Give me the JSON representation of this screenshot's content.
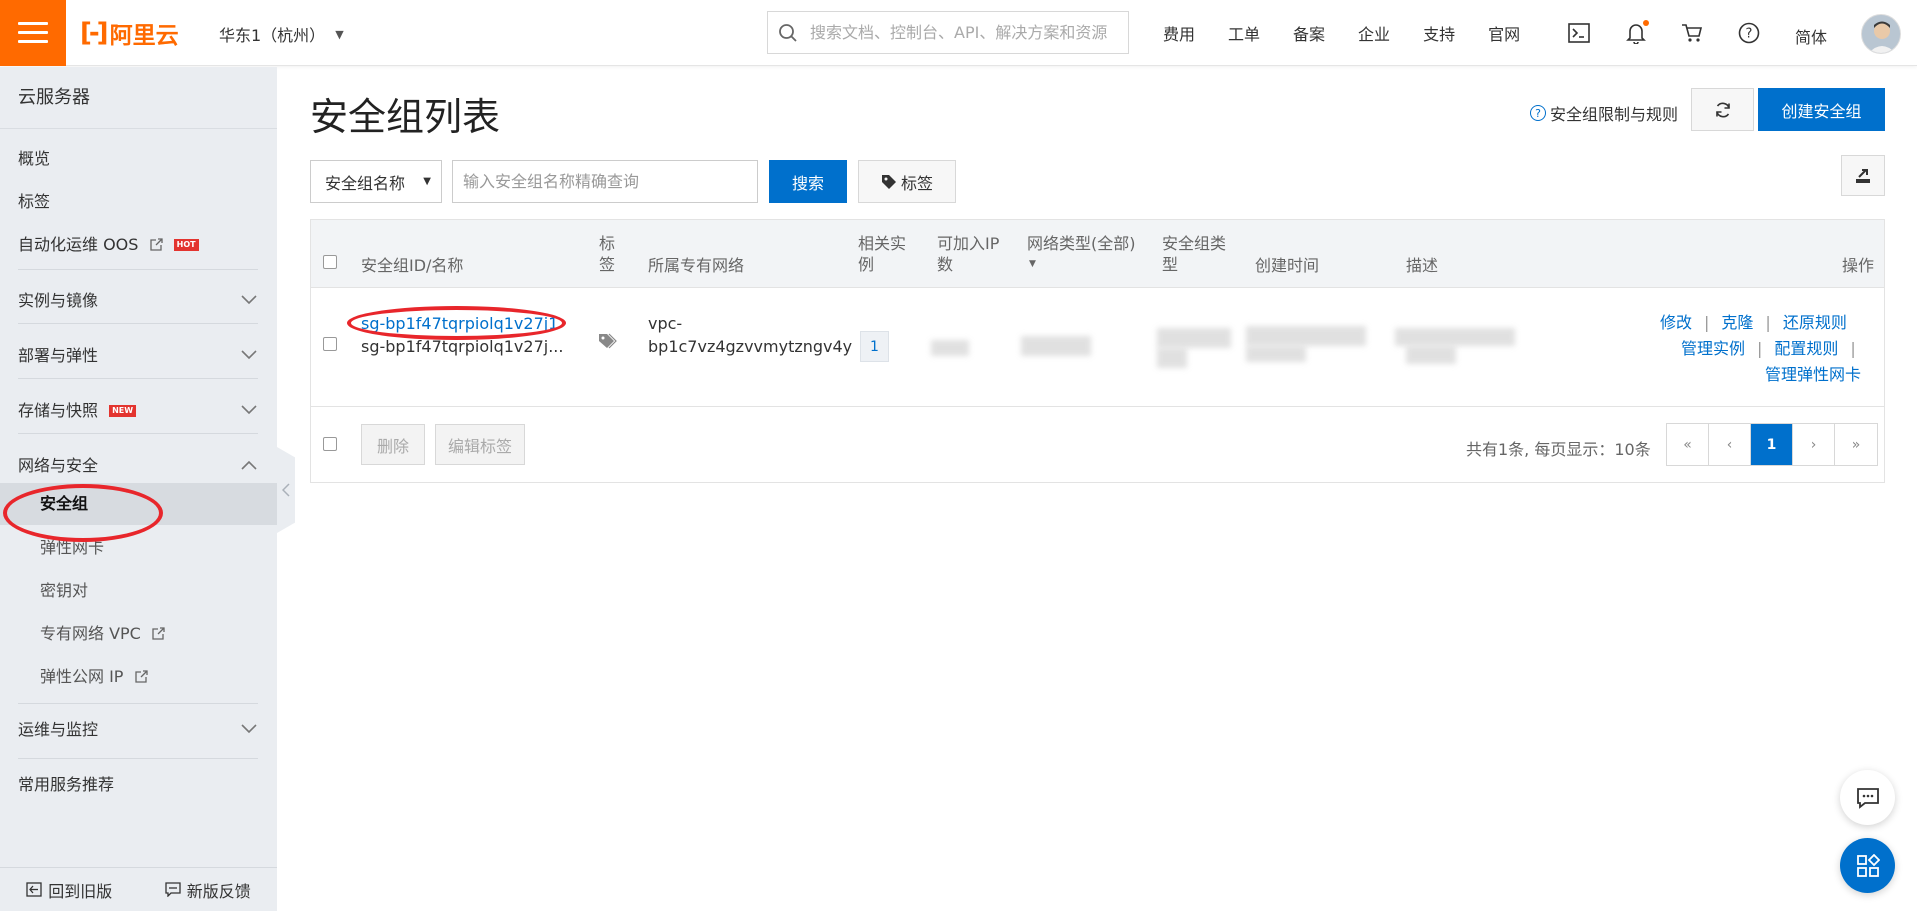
{
  "header": {
    "logo_text": "阿里云",
    "region": "华东1（杭州）",
    "search_placeholder": "搜索文档、控制台、API、解决方案和资源",
    "nav": [
      "费用",
      "工单",
      "备案",
      "企业",
      "支持",
      "官网"
    ],
    "language": "简体",
    "icons": [
      "menu-icon",
      "terminal-icon",
      "bell-icon",
      "cart-icon",
      "help-icon"
    ],
    "accent_color": "#ff6a00"
  },
  "sidebar": {
    "title": "云服务器",
    "items": [
      {
        "label": "概览"
      },
      {
        "label": "标签"
      },
      {
        "label": "自动化运维 OOS",
        "badge": "HOT"
      },
      {
        "label": "实例与镜像"
      },
      {
        "label": "部署与弹性"
      },
      {
        "label": "存储与快照",
        "badge": "NEW"
      },
      {
        "label": "网络与安全"
      },
      {
        "label": "安全组"
      },
      {
        "label": "弹性网卡"
      },
      {
        "label": "密钥对"
      },
      {
        "label": "专有网络 VPC"
      },
      {
        "label": "弹性公网 IP"
      },
      {
        "label": "运维与监控"
      },
      {
        "label": "常用服务推荐"
      }
    ],
    "footer": {
      "back_old": "回到旧版",
      "feedback": "新版反馈"
    }
  },
  "main": {
    "title": "安全组列表",
    "help_link": "安全组限制与规则",
    "create_button": "创建安全组",
    "filter": {
      "select_value": "安全组名称",
      "input_placeholder": "输入安全组名称精确查询",
      "search_button": "搜索",
      "tag_button": "标签"
    },
    "table": {
      "headers": {
        "id_name": "安全组ID/名称",
        "tag_line1": "标",
        "tag_line2": "签",
        "vpc": "所属专有网络",
        "instances_line1": "相关实",
        "instances_line2": "例",
        "ips_line1": "可加入IP",
        "ips_line2": "数",
        "net_type": "网络类型(全部)",
        "sg_type_line1": "安全组类",
        "sg_type_line2": "型",
        "created": "创建时间",
        "desc": "描述",
        "ops": "操作"
      },
      "rows": [
        {
          "id": "sg-bp1f47tqrpiolq1v27j1",
          "name": "sg-bp1f47tqrpiolq1v27j...",
          "vpc_line1": "vpc-",
          "vpc_line2": "bp1c7vz4gzvvmytzngv4y",
          "instances": "1",
          "actions": {
            "modify": "修改",
            "clone": "克隆",
            "restore": "还原规则",
            "manage_instances": "管理实例",
            "config_rules": "配置规则",
            "manage_eni": "管理弹性网卡"
          }
        }
      ],
      "footer": {
        "delete": "删除",
        "edit_tags": "编辑标签",
        "pager_info": "共有1条, 每页显示：10条",
        "pages": [
          "«",
          "‹",
          "1",
          "›",
          "»"
        ],
        "current_page": "1"
      }
    }
  }
}
